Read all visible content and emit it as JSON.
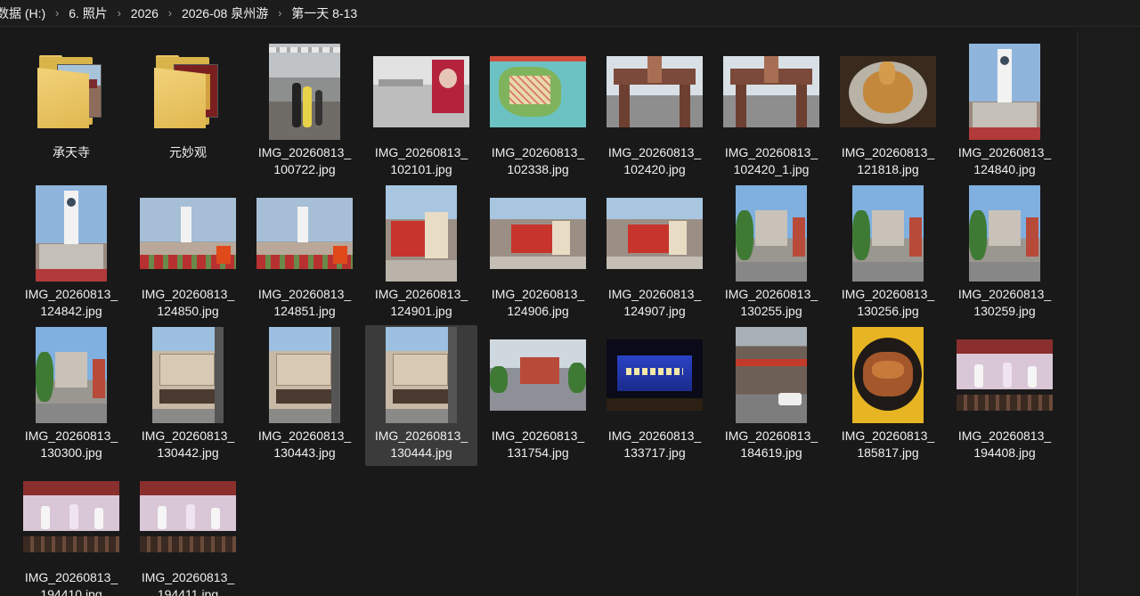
{
  "breadcrumb": [
    "数据 (H:)",
    "6. 照片",
    "2026",
    "2026-08 泉州游",
    "第一天 8-13"
  ],
  "items": [
    {
      "type": "folder",
      "line1": "承天寺",
      "line2": "",
      "scene": "temple"
    },
    {
      "type": "folder",
      "line1": "元妙观",
      "line2": "",
      "scene": "gate"
    },
    {
      "type": "image",
      "line1": "IMG_20260813_",
      "line2": "100722.jpg",
      "scene": "station"
    },
    {
      "type": "image",
      "line1": "IMG_20260813_",
      "line2": "102101.jpg",
      "scene": "hall"
    },
    {
      "type": "image",
      "line1": "IMG_20260813_",
      "line2": "102338.jpg",
      "scene": "map"
    },
    {
      "type": "image",
      "line1": "IMG_20260813_",
      "line2": "102420.jpg",
      "scene": "arch"
    },
    {
      "type": "image",
      "line1": "IMG_20260813_",
      "line2": "102420_1.jpg",
      "scene": "arch"
    },
    {
      "type": "image",
      "line1": "IMG_20260813_",
      "line2": "121818.jpg",
      "scene": "food"
    },
    {
      "type": "image",
      "line1": "IMG_20260813_",
      "line2": "124840.jpg",
      "scene": "tower"
    },
    {
      "type": "image",
      "line1": "IMG_20260813_",
      "line2": "124842.jpg",
      "scene": "tower"
    },
    {
      "type": "image",
      "line1": "IMG_20260813_",
      "line2": "124850.jpg",
      "scene": "towerwide"
    },
    {
      "type": "image",
      "line1": "IMG_20260813_",
      "line2": "124851.jpg",
      "scene": "towerwide"
    },
    {
      "type": "image",
      "line1": "IMG_20260813_",
      "line2": "124901.jpg",
      "scene": "sign"
    },
    {
      "type": "image",
      "line1": "IMG_20260813_",
      "line2": "124906.jpg",
      "scene": "signwide"
    },
    {
      "type": "image",
      "line1": "IMG_20260813_",
      "line2": "124907.jpg",
      "scene": "signwide"
    },
    {
      "type": "image",
      "line1": "IMG_20260813_",
      "line2": "130255.jpg",
      "scene": "church"
    },
    {
      "type": "image",
      "line1": "IMG_20260813_",
      "line2": "130256.jpg",
      "scene": "church"
    },
    {
      "type": "image",
      "line1": "IMG_20260813_",
      "line2": "130259.jpg",
      "scene": "church"
    },
    {
      "type": "image",
      "line1": "IMG_20260813_",
      "line2": "130300.jpg",
      "scene": "church"
    },
    {
      "type": "image",
      "line1": "IMG_20260813_",
      "line2": "130442.jpg",
      "scene": "shop"
    },
    {
      "type": "image",
      "line1": "IMG_20260813_",
      "line2": "130443.jpg",
      "scene": "shop"
    },
    {
      "type": "image",
      "line1": "IMG_20260813_",
      "line2": "130444.jpg",
      "scene": "shop",
      "selected": true
    },
    {
      "type": "image",
      "line1": "IMG_20260813_",
      "line2": "131754.jpg",
      "scene": "square"
    },
    {
      "type": "image",
      "line1": "IMG_20260813_",
      "line2": "133717.jpg",
      "scene": "stage"
    },
    {
      "type": "image",
      "line1": "IMG_20260813_",
      "line2": "184619.jpg",
      "scene": "street"
    },
    {
      "type": "image",
      "line1": "IMG_20260813_",
      "line2": "185817.jpg",
      "scene": "crab"
    },
    {
      "type": "image",
      "line1": "IMG_20260813_",
      "line2": "194408.jpg",
      "scene": "opera"
    },
    {
      "type": "image",
      "line1": "IMG_20260813_",
      "line2": "194410.jpg",
      "scene": "opera"
    },
    {
      "type": "image",
      "line1": "IMG_20260813_",
      "line2": "194411.jpg",
      "scene": "opera"
    }
  ]
}
